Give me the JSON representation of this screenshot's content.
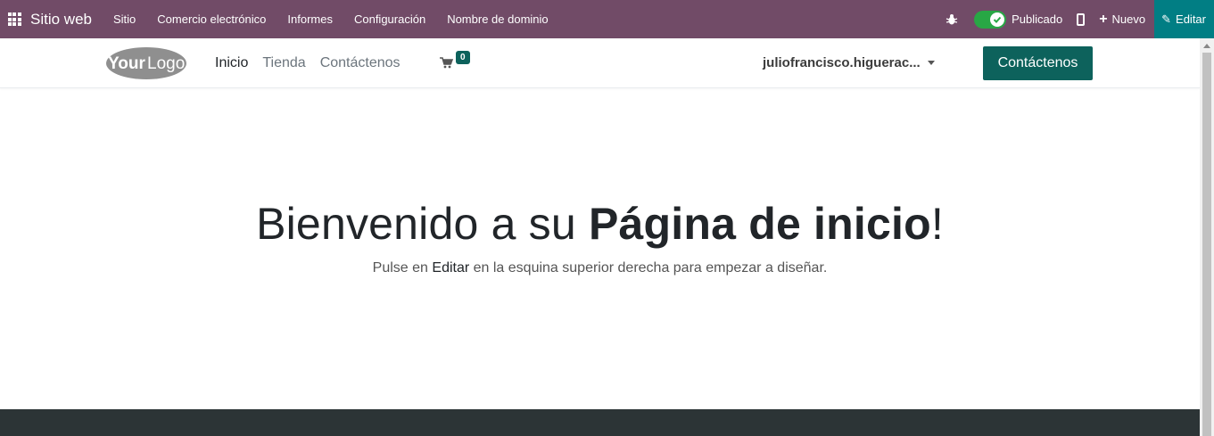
{
  "topbar": {
    "brand": "Sitio web",
    "menu": [
      "Sitio",
      "Comercio electrónico",
      "Informes",
      "Configuración",
      "Nombre de dominio"
    ],
    "published_label": "Publicado",
    "new_label": "Nuevo",
    "edit_label": "Editar",
    "bg_color": "#714b67",
    "edit_bg_color": "#017e84"
  },
  "header": {
    "logo_text_1": "Your",
    "logo_text_2": "Logo",
    "nav": [
      "Inicio",
      "Tienda",
      "Contáctenos"
    ],
    "cart_count": "0",
    "user_name": "juliofrancisco.higuerac...",
    "cta_label": "Contáctenos",
    "accent_color": "#0d625c"
  },
  "hero": {
    "title_normal_1": "Bienvenido a su ",
    "title_bold": "Página de inicio",
    "title_normal_2": "!",
    "sub_1": "Pulse en ",
    "sub_strong": "Editar",
    "sub_2": " en la esquina superior derecha para empezar a diseñar."
  }
}
